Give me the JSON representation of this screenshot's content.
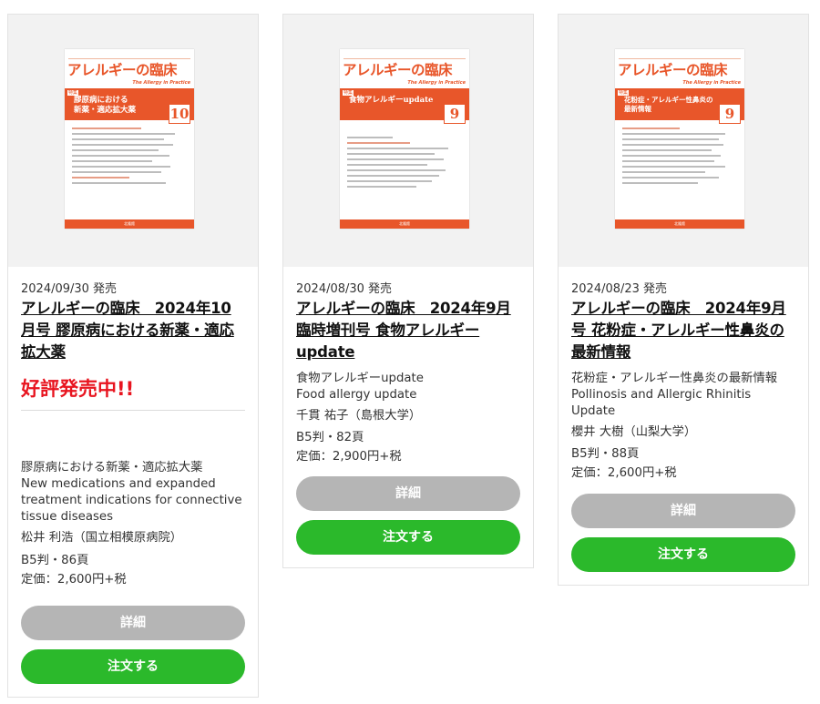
{
  "products": [
    {
      "cover": {
        "brand": "アレルギーの臨床",
        "subtitle": "The Allergy in Practice",
        "tokushu": "特集",
        "band_text": "膠原病における\n新薬・適応拡大薬",
        "issue_number": "10",
        "publisher": "北隆館"
      },
      "date": "2024/09/30 発売",
      "title": "アレルギーの臨床　2024年10月号 膠原病における新薬・適応拡大薬",
      "sale_label": "好評発売中!!",
      "description_ja": "膠原病における新薬・適応拡大薬",
      "description_en": "New medications and expanded treatment indications for connective tissue diseases",
      "editor": "松井 利浩（国立相模原病院）",
      "format": "B5判・86頁",
      "price": "定価：2,600円+税",
      "detail_label": "詳細",
      "order_label": "注文する"
    },
    {
      "cover": {
        "brand": "アレルギーの臨床",
        "subtitle": "The Allergy in Practice",
        "tokushu": "特集",
        "band_text": "食物アレルギーupdate",
        "issue_number": "9",
        "publisher": "北隆館"
      },
      "date": "2024/08/30 発売",
      "title": "アレルギーの臨床　2024年9月臨時増刊号 食物アレルギーupdate",
      "description_ja": "食物アレルギーupdate",
      "description_en": "Food allergy update",
      "editor": "千貫 祐子（島根大学）",
      "format": "B5判・82頁",
      "price": "定価：2,900円+税",
      "detail_label": "詳細",
      "order_label": "注文する"
    },
    {
      "cover": {
        "brand": "アレルギーの臨床",
        "subtitle": "The Allergy in Practice",
        "tokushu": "特集",
        "band_text": "花粉症・アレルギー性鼻炎の\n最新情報",
        "issue_number": "9",
        "publisher": "北隆館"
      },
      "date": "2024/08/23 発売",
      "title": "アレルギーの臨床　2024年9月号 花粉症・アレルギー性鼻炎の最新情報",
      "description_ja": "花粉症・アレルギー性鼻炎の最新情報",
      "description_en": "Pollinosis and Allergic Rhinitis Update",
      "editor": "櫻井 大樹（山梨大学）",
      "format": "B5判・88頁",
      "price": "定価：2,600円+税",
      "detail_label": "詳細",
      "order_label": "注文する"
    }
  ],
  "colors": {
    "accent_orange": "#e8562a",
    "sale_red": "#e8141f",
    "order_green": "#2bb92b",
    "detail_gray": "#b5b5b5"
  }
}
